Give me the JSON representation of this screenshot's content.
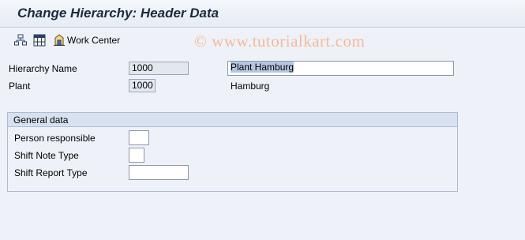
{
  "window": {
    "title": "Change Hierarchy: Header Data"
  },
  "toolbar": {
    "items": [
      {
        "icon": "hierarchy-icon"
      },
      {
        "icon": "grid-icon"
      },
      {
        "icon": "work-center-icon",
        "label": "Work Center"
      }
    ]
  },
  "watermark": "© www.tutorialkart.com",
  "header": {
    "hierarchy_name": {
      "label": "Hierarchy Name",
      "value": "1000",
      "description": "Plant Hamburg"
    },
    "plant": {
      "label": "Plant",
      "value": "1000",
      "description": "Hamburg"
    }
  },
  "general_data": {
    "title": "General data",
    "person_responsible": {
      "label": "Person responsible",
      "value": ""
    },
    "shift_note_type": {
      "label": "Shift Note Type",
      "value": ""
    },
    "shift_report_type": {
      "label": "Shift Report Type",
      "value": ""
    }
  }
}
